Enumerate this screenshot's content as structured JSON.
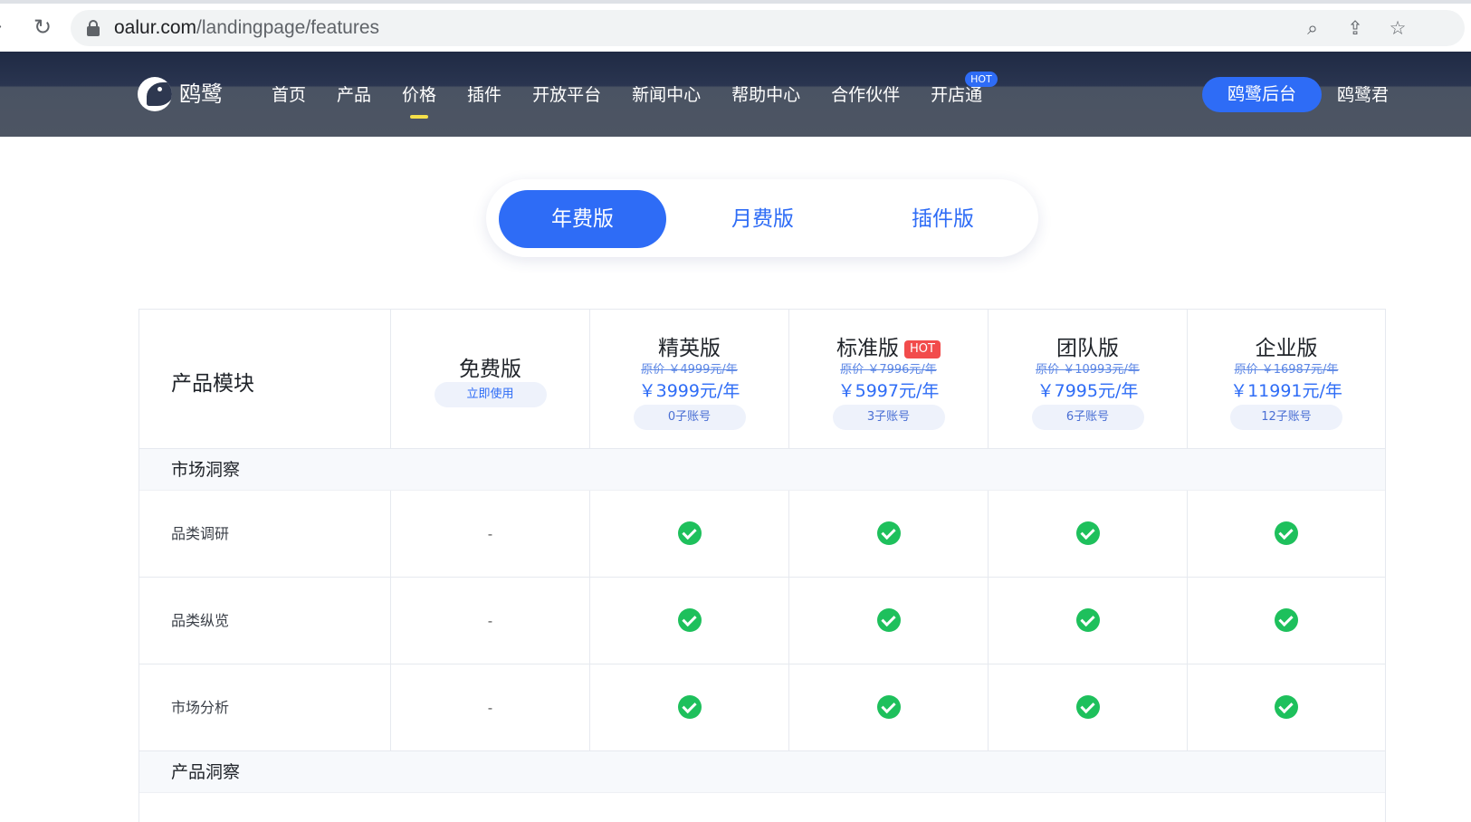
{
  "browser": {
    "url_host": "oalur.com",
    "url_path": "/landingpage/features"
  },
  "header": {
    "logo_text": "鸥鹭",
    "nav": [
      {
        "label": "首页"
      },
      {
        "label": "产品"
      },
      {
        "label": "价格",
        "active": true
      },
      {
        "label": "插件"
      },
      {
        "label": "开放平台"
      },
      {
        "label": "新闻中心"
      },
      {
        "label": "帮助中心"
      },
      {
        "label": "合作伙伴"
      },
      {
        "label": "开店通",
        "badge": "HOT"
      }
    ],
    "console_button": "鸥鹭后台",
    "user_name": "鸥鹭君"
  },
  "plan_tabs": [
    {
      "label": "年费版",
      "active": true
    },
    {
      "label": "月费版"
    },
    {
      "label": "插件版"
    }
  ],
  "table": {
    "module_header": "产品模块",
    "plans": [
      {
        "name": "免费版",
        "action": "立即使用"
      },
      {
        "name": "精英版",
        "original": "原价 ￥4999元/年",
        "price": "￥3999元/年",
        "accounts": "0子账号"
      },
      {
        "name": "标准版",
        "badge": "HOT",
        "original": "原价 ￥7996元/年",
        "price": "￥5997元/年",
        "accounts": "3子账号"
      },
      {
        "name": "团队版",
        "original": "原价 ￥10993元/年",
        "price": "￥7995元/年",
        "accounts": "6子账号"
      },
      {
        "name": "企业版",
        "original": "原价 ￥16987元/年",
        "price": "￥11991元/年",
        "accounts": "12子账号"
      }
    ],
    "sections": [
      {
        "label": "市场洞察",
        "features": [
          {
            "label": "品类调研",
            "values": [
              "-",
              "check",
              "check",
              "check",
              "check"
            ]
          },
          {
            "label": "品类纵览",
            "values": [
              "-",
              "check",
              "check",
              "check",
              "check"
            ]
          },
          {
            "label": "市场分析",
            "values": [
              "-",
              "check",
              "check",
              "check",
              "check"
            ]
          }
        ]
      },
      {
        "label": "产品洞察",
        "features": []
      }
    ]
  }
}
